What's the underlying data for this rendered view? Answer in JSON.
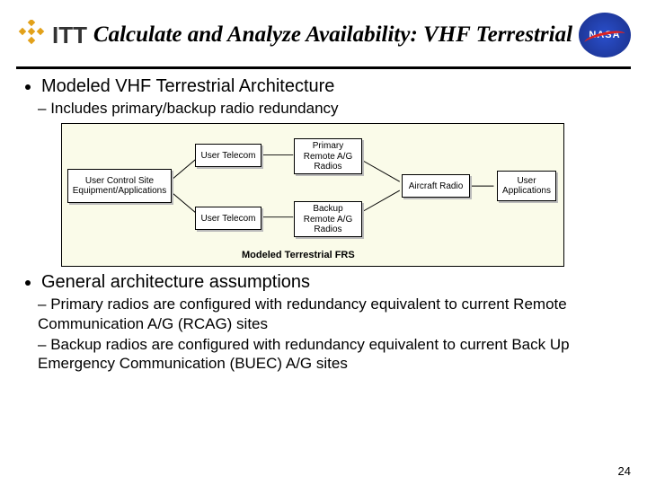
{
  "header": {
    "left_logo_name": "itt-logo",
    "left_logo_text": "ITT",
    "title": "Calculate and Analyze Availability: VHF Terrestrial",
    "right_logo_name": "nasa-logo",
    "right_logo_text": "NASA"
  },
  "bullets": {
    "b1": "Modeled VHF Terrestrial Architecture",
    "b1_sub1": "Includes primary/backup radio redundancy",
    "b2": "General architecture assumptions",
    "b2_sub1": "Primary radios are configured with redundancy equivalent to current Remote Communication A/G (RCAG) sites",
    "b2_sub2": "Backup radios are configured with redundancy equivalent to current Back Up Emergency Communication (BUEC) A/G sites"
  },
  "diagram": {
    "caption": "Modeled Terrestrial FRS",
    "boxes": {
      "ucse": "User Control Site Equipment/Applications",
      "ut1": "User Telecom",
      "ut2": "User Telecom",
      "prim": "Primary Remote A/G Radios",
      "back": "Backup Remote A/G Radios",
      "aircraft": "Aircraft Radio",
      "userapps": "User Applications"
    }
  },
  "page_number": "24"
}
